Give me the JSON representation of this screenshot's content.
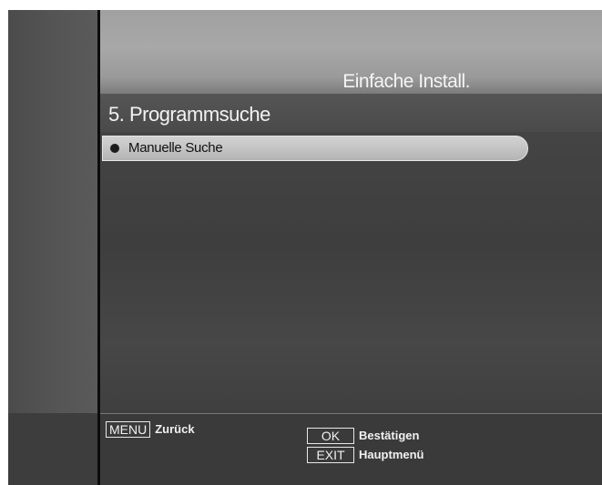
{
  "header": {
    "title": "Einfache Install."
  },
  "section": {
    "title": "5. Programmsuche"
  },
  "list": {
    "items": [
      {
        "label": "Manuelle Suche",
        "selected": true
      }
    ]
  },
  "footer": {
    "menu_key": "MENU",
    "menu_label": "Zurück",
    "ok_key": "OK",
    "ok_label": "Bestätigen",
    "exit_key": "EXIT",
    "exit_label": "Hauptmenü"
  },
  "icons": {
    "bullet": "bullet-icon"
  },
  "colors": {
    "header_bg": "#a4a4a4",
    "body_bg": "#3a3a3a",
    "selected_item_bg": "#c6c6c6",
    "text_light": "#f2f2f2",
    "text_dark": "#111111"
  }
}
